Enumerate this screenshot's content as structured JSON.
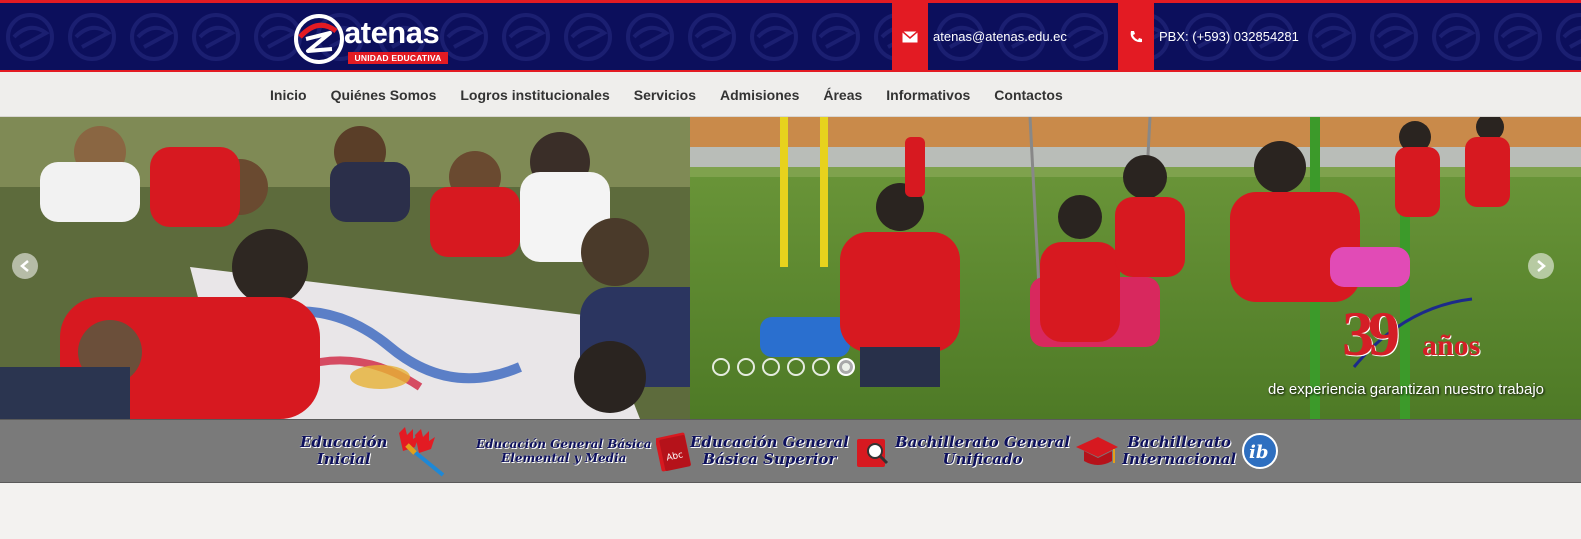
{
  "brand": {
    "name": "atenas",
    "subtitle": "UNIDAD EDUCATIVA"
  },
  "contact": {
    "email_icon": "envelope-icon",
    "email": "atenas@atenas.edu.ec",
    "phone_icon": "phone-icon",
    "phone": "PBX: (+593) 032854281"
  },
  "nav": {
    "items": [
      {
        "label": "Inicio"
      },
      {
        "label": "Quiénes Somos"
      },
      {
        "label": "Logros institucionales"
      },
      {
        "label": "Servicios"
      },
      {
        "label": "Admisiones"
      },
      {
        "label": "Áreas"
      },
      {
        "label": "Informativos"
      },
      {
        "label": "Contactos"
      }
    ]
  },
  "slider": {
    "years_number": "39",
    "years_word": "años",
    "tagline": "de experiencia garantizan nuestro trabajo",
    "slide_count": 6,
    "active_slide": 6
  },
  "levels": [
    {
      "line1": "Educación",
      "line2": "Inicial",
      "icon": "painted-hands-icon"
    },
    {
      "line1": "Educación General Básica",
      "line2": "Elemental y Media",
      "icon": "abc-book-icon"
    },
    {
      "line1": "Educación General",
      "line2": "Básica Superior",
      "icon": "magnifier-book-icon"
    },
    {
      "line1": "Bachillerato General",
      "line2": "Unificado",
      "icon": "graduation-cap-icon"
    },
    {
      "line1": "Bachillerato",
      "line2": "Internacional",
      "icon": "ib-logo-icon"
    }
  ],
  "colors": {
    "header_bg": "#0c0f5c",
    "accent_red": "#e31b23",
    "nav_bg": "#efeeec",
    "levels_bg": "#7a7a7a"
  }
}
